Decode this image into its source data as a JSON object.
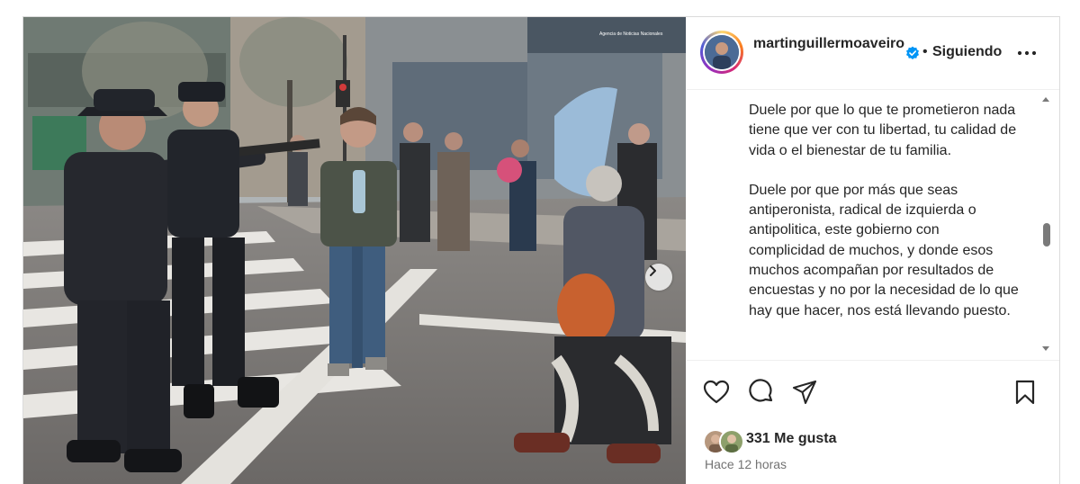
{
  "photo": {
    "alt": "",
    "watermark_line1": "",
    "watermark_line2": "Agencia de Noticias Nacionales"
  },
  "post": {
    "username": "martinguillermoaveiro",
    "follow_status": "Siguiendo",
    "separator": "•",
    "caption_paragraphs": [
      "Duele por que lo que te prometieron nada tiene que ver con tu libertad, tu calidad de vida o el bienestar de tu familia.",
      "Duele por que por más que seas antiperonista, radical de izquierda o antipolitica, este gobierno con complicidad de muchos, y donde esos muchos acompañan por resultados de encuestas y no por la necesidad de lo que hay que hacer, nos está llevando puesto."
    ],
    "likes": "331 Me gusta",
    "time_ago": "Hace 12 horas"
  },
  "icons": {
    "like": "heart-icon",
    "comment": "comment-icon",
    "share": "paper-plane-icon",
    "save": "bookmark-icon",
    "more": "more-options-icon",
    "verified": "verified-badge-icon",
    "next": "chevron-right-icon"
  },
  "colors": {
    "verified": "#0095f6",
    "text": "#262626",
    "secondary_text": "#737373",
    "border": "#dbdbdb"
  }
}
